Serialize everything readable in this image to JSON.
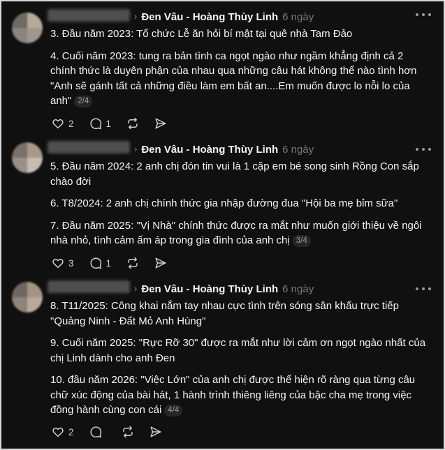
{
  "thread_title": "Đen Vâu - Hoàng Thùy Linh",
  "time_label": "6 ngày",
  "posts": [
    {
      "paragraphs": [
        "3. Đầu năm 2023: Tổ chức Lễ ăn hỏi bí mật tại quê nhà Tam Đảo",
        "4. Cuối năm 2023: tung ra bản tình ca ngọt ngào như ngầm khẳng định cả 2 chính thức là duyên phận của nhau qua những câu hát không thể nào tình hơn \"Anh sẽ gánh tất cả những điều làm em bất an....Em muốn được lo nỗi lo của anh\""
      ],
      "pager": "2/4",
      "likes": "2",
      "replies": "1",
      "avatar_colors": [
        "#6e6a64",
        "#b9a999",
        "#8a8580",
        "#a09890"
      ]
    },
    {
      "paragraphs": [
        "5. Đầu năm 2024: 2 anh chị đón tin vui là 1 cặp em bé song sinh Rồng Con sắp chào đời",
        "6. T8/2024: 2 anh chị chính thức gia nhập đường đua \"Hội ba mẹ bỉm sữa\"",
        "7. Đầu năm 2025: \"Vị Nhà\" chính thức được ra mắt như muốn giới thiệu về ngôi nhà nhỏ, tình cảm ấm áp trong gia đình của anh chị"
      ],
      "pager": "3/4",
      "likes": "3",
      "replies": "1",
      "avatar_colors": [
        "#7a7068",
        "#a8988a",
        "#9b9088",
        "#c7bcb0"
      ]
    },
    {
      "paragraphs": [
        "8. T11/2025: Công khai nắm tay nhau cực tình trên sóng sân khấu trực tiếp \"Quảng Ninh - Đất Mỏ Anh Hùng\"",
        "9. Cuối năm 2025: \"Rực Rỡ 30\" được ra mắt như lời cảm ơn ngọt ngào nhất của chị Linh dành cho anh Đen",
        "10. đầu năm 2026: \"Việc Lớn\" của anh chị được thể hiện rõ ràng qua từng câu chữ xúc động của bài hát, 1 hành trình thiêng liêng của bậc cha mẹ trong việc đồng hành cùng con cái"
      ],
      "pager": "4/4",
      "likes": "2",
      "replies": "",
      "avatar_colors": [
        "#6f675f",
        "#a49484",
        "#8f8479",
        "#b7aa9c"
      ]
    }
  ]
}
